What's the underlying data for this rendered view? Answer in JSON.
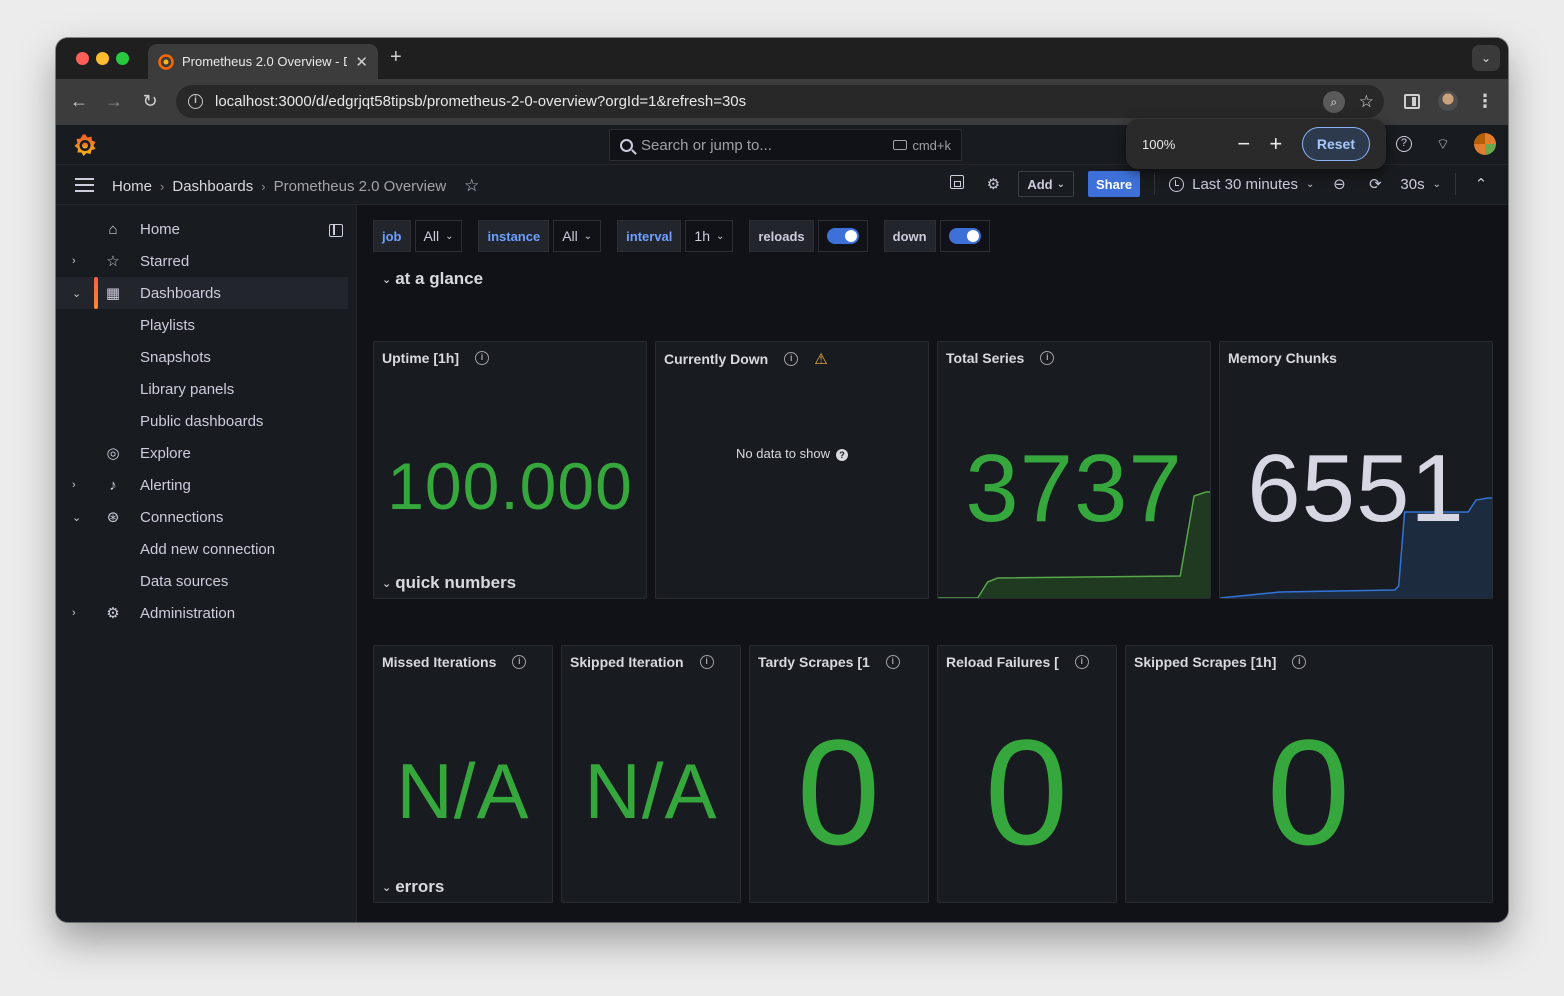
{
  "browser": {
    "tab_title": "Prometheus 2.0 Overview - D",
    "url": "localhost:3000/d/edgrjqt58tipsb/prometheus-2-0-overview?orgId=1&refresh=30s",
    "zoom_value": "100%",
    "zoom_reset_label": "Reset"
  },
  "topbar": {
    "search_placeholder": "Search or jump to...",
    "search_shortcut": "cmd+k"
  },
  "breadcrumb": {
    "home": "Home",
    "dashboards": "Dashboards",
    "current": "Prometheus 2.0 Overview"
  },
  "toolbar": {
    "add_label": "Add",
    "share_label": "Share",
    "time_range": "Last 30 minutes",
    "refresh_interval": "30s"
  },
  "sidebar": {
    "items": [
      {
        "label": "Home",
        "icon": "home-icon"
      },
      {
        "label": "Starred",
        "icon": "star-icon"
      },
      {
        "label": "Dashboards",
        "icon": "apps-icon"
      },
      {
        "label": "Playlists"
      },
      {
        "label": "Snapshots"
      },
      {
        "label": "Library panels"
      },
      {
        "label": "Public dashboards"
      },
      {
        "label": "Explore",
        "icon": "compass-icon"
      },
      {
        "label": "Alerting",
        "icon": "bell-icon"
      },
      {
        "label": "Connections",
        "icon": "connections-icon"
      },
      {
        "label": "Add new connection"
      },
      {
        "label": "Data sources"
      },
      {
        "label": "Administration",
        "icon": "cog-icon"
      }
    ]
  },
  "variables": {
    "job_label": "job",
    "job_value": "All",
    "instance_label": "instance",
    "instance_value": "All",
    "interval_label": "interval",
    "interval_value": "1h",
    "reloads_label": "reloads",
    "reloads_on": true,
    "down_label": "down",
    "down_on": true
  },
  "rows": {
    "glance": "at a glance",
    "quick": "quick numbers",
    "errors": "errors"
  },
  "panels": {
    "uptime": {
      "title": "Uptime [1h]",
      "value": "100.000"
    },
    "down": {
      "title": "Currently Down",
      "no_data": "No data to show"
    },
    "series": {
      "title": "Total Series",
      "value": "3737"
    },
    "chunks": {
      "title": "Memory Chunks",
      "value": "6551"
    },
    "missed": {
      "title": "Missed Iterations",
      "value": "N/A"
    },
    "skipped_iter": {
      "title": "Skipped Iteration",
      "value": "N/A"
    },
    "tardy": {
      "title": "Tardy Scrapes [1",
      "value": "0"
    },
    "reload_fail": {
      "title": "Reload Failures [",
      "value": "0"
    },
    "skipped_scrapes": {
      "title": "Skipped Scrapes [1h]",
      "value": "0"
    }
  },
  "colors": {
    "value_green": "#36a73c",
    "value_grey": "#d7d7e4",
    "accent_blue": "#3d71d9",
    "series_spark": "#56a64b",
    "chunks_spark": "#3274d9"
  }
}
